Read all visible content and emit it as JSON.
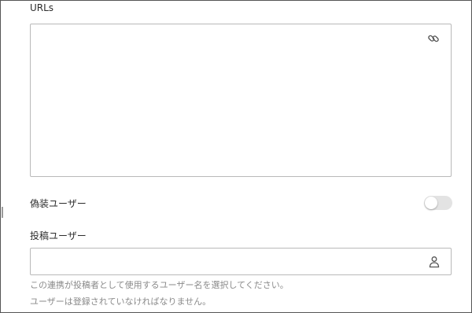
{
  "urls": {
    "label": "URLs",
    "value": "",
    "icon": "link-icon"
  },
  "impersonate": {
    "label": "偽装ユーザー",
    "enabled": false
  },
  "poster": {
    "label": "投稿ユーザー",
    "value": "",
    "icon": "user-icon",
    "help_line1": "この連携が投稿者として使用するユーザー名を選択してください。",
    "help_line2": "ユーザーは登録されていなければなりません。"
  }
}
